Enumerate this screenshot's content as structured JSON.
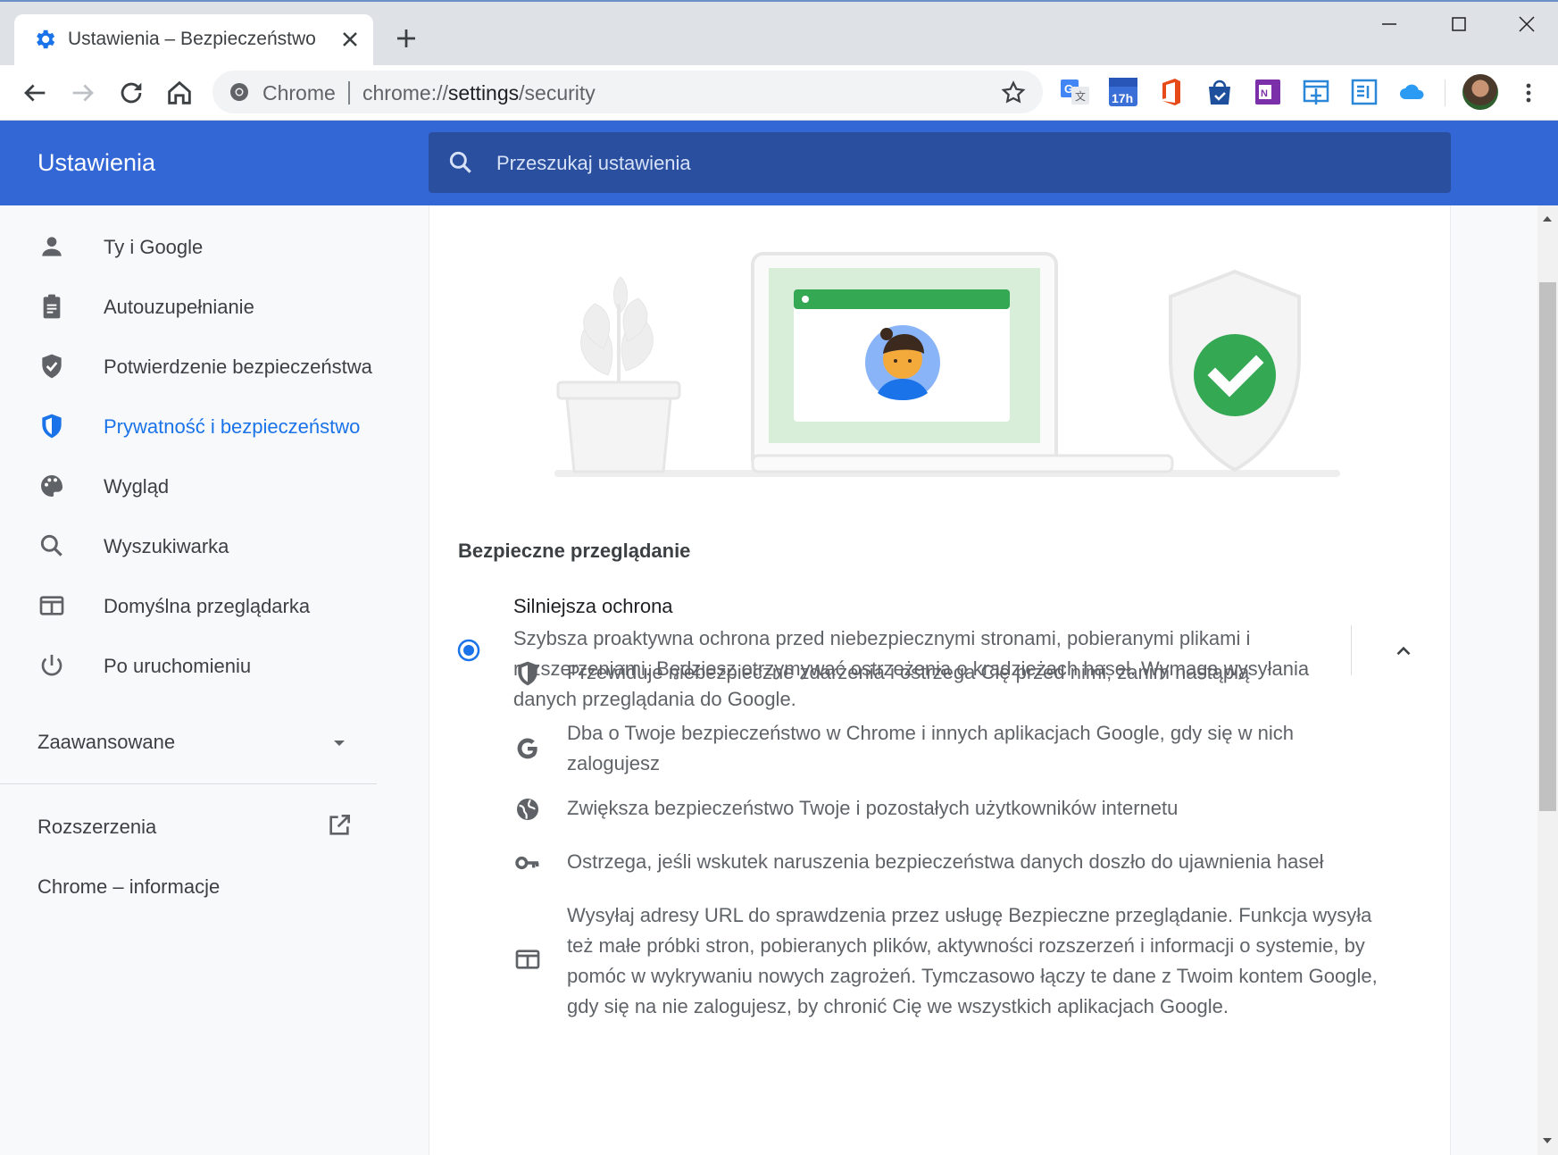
{
  "tab": {
    "title": "Ustawienia – Bezpieczeństwo"
  },
  "omnibox": {
    "site_label": "Chrome",
    "url_prefix": "chrome://",
    "url_host": "settings",
    "url_path": "/security"
  },
  "extensions": [
    {
      "icon": "google-translate-icon",
      "color": "#4285f4"
    },
    {
      "icon": "calendar-icon",
      "badge": "17h",
      "color": "#3a6fd8"
    },
    {
      "icon": "office-icon",
      "color": "#e64a19"
    },
    {
      "icon": "shopping-bag-icon",
      "color": "#1e4f9c"
    },
    {
      "icon": "onenote-icon",
      "color": "#7b2fa8"
    },
    {
      "icon": "web-capture-icon",
      "color": "#2b88d8"
    },
    {
      "icon": "immersive-reader-icon",
      "color": "#2b88d8"
    },
    {
      "icon": "cloud-icon",
      "color": "#2b9af3"
    }
  ],
  "header": {
    "title": "Ustawienia",
    "search_placeholder": "Przeszukaj ustawienia"
  },
  "sidebar": {
    "items": [
      {
        "label": "Ty i Google",
        "icon": "person-icon"
      },
      {
        "label": "Autouzupełnianie",
        "icon": "clipboard-icon"
      },
      {
        "label": "Potwierdzenie bezpieczeństwa",
        "icon": "shield-icon"
      },
      {
        "label": "Prywatność i bezpieczeństwo",
        "icon": "privacy-shield-icon",
        "active": true
      },
      {
        "label": "Wygląd",
        "icon": "palette-icon"
      },
      {
        "label": "Wyszukiwarka",
        "icon": "search-icon"
      },
      {
        "label": "Domyślna przeglądarka",
        "icon": "browser-icon"
      },
      {
        "label": "Po uruchomieniu",
        "icon": "power-icon"
      }
    ],
    "advanced": "Zaawansowane",
    "extensions": "Rozszerzenia",
    "about": "Chrome – informacje"
  },
  "content": {
    "section_title": "Bezpieczne przeglądanie",
    "option": {
      "title": "Silniejsza ochrona",
      "description": "Szybsza proaktywna ochrona przed niebezpiecznymi stronami, pobieranymi plikami i rozszerzeniami. Będziesz otrzymywać ostrzeżenia o kradzieżach haseł. Wymaga wysyłania danych przeglądania do Google.",
      "selected": true
    },
    "features": [
      {
        "icon": "shield-half-icon",
        "text": "Przewiduje niebezpieczne zdarzenia i ostrzega Cię przed nimi, zanim nastąpią"
      },
      {
        "icon": "google-g-icon",
        "text": "Dba o Twoje bezpieczeństwo w Chrome i innych aplikacjach Google, gdy się w nich zalogujesz"
      },
      {
        "icon": "globe-icon",
        "text": "Zwiększa bezpieczeństwo Twoje i pozostałych użytkowników internetu"
      },
      {
        "icon": "key-icon",
        "text": "Ostrzega, jeśli wskutek naruszenia bezpieczeństwa danych doszło do ujawnienia haseł"
      },
      {
        "icon": "web-page-icon",
        "text": "Wysyłaj adresy URL do sprawdzenia przez usługę Bezpieczne przeglądanie. Funkcja wysyła też małe próbki stron, pobieranych plików, aktywności rozszerzeń i informacji o systemie, by pomóc w wykrywaniu nowych zagrożeń. Tymczasowo łączy te dane z Twoim kontem Google, gdy się na nie zalogujesz, by chronić Cię we wszystkich aplikacjach Google."
      }
    ]
  },
  "colors": {
    "accent": "#1a73e8",
    "header_bg": "#3367d6",
    "search_bg": "#2a4f9f",
    "check_green": "#34a853"
  }
}
